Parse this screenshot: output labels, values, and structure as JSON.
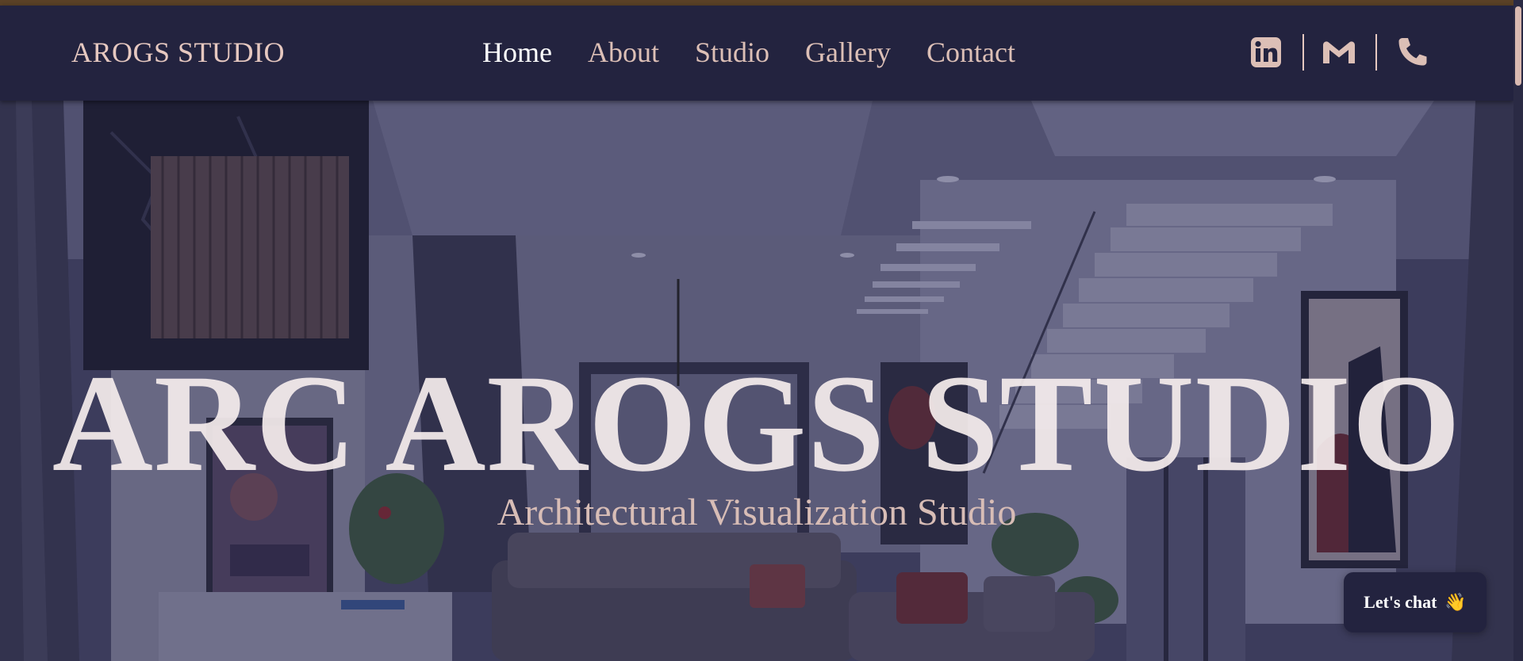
{
  "brand": "AROGS STUDIO",
  "nav": {
    "items": [
      {
        "label": "Home",
        "active": true
      },
      {
        "label": "About",
        "active": false
      },
      {
        "label": "Studio",
        "active": false
      },
      {
        "label": "Gallery",
        "active": false
      },
      {
        "label": "Contact",
        "active": false
      }
    ]
  },
  "social": {
    "icons": [
      "linkedin-icon",
      "gmail-icon",
      "phone-icon"
    ]
  },
  "hero": {
    "title": "ARC AROGS STUDIO",
    "subtitle": "Architectural Visualization Studio",
    "image_alt": "Modern living room interior with staircase"
  },
  "chat": {
    "label": "Let's chat",
    "emoji": "👋"
  },
  "colors": {
    "nav_bg": "#23233f",
    "accent": "#e6c8c0",
    "active_link": "#ffffff",
    "top_stripe": "#5a4126"
  }
}
